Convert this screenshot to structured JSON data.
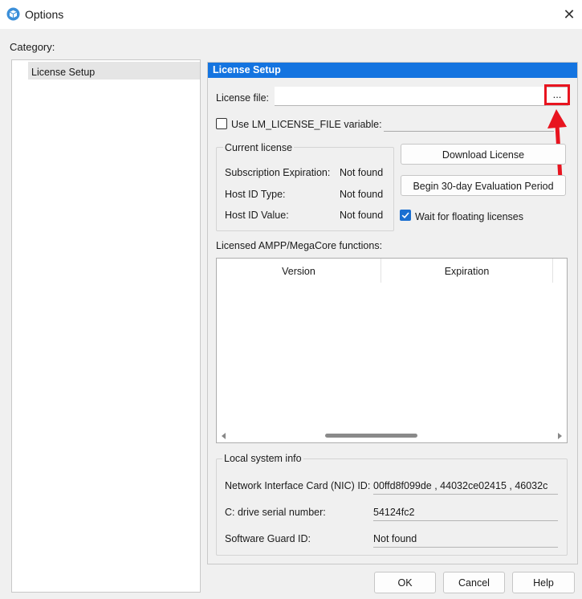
{
  "window": {
    "title": "Options",
    "close_glyph": "✕",
    "icon": "app-cube-icon"
  },
  "category": {
    "label": "Category:",
    "items": [
      {
        "label": "License Setup",
        "selected": true
      }
    ]
  },
  "panel": {
    "header": "License Setup",
    "license_file": {
      "label": "License file:",
      "value": "",
      "browse_label": "..."
    },
    "lm_variable": {
      "label": "Use LM_LICENSE_FILE variable:",
      "checked": false,
      "value": ""
    },
    "current_license": {
      "title": "Current license",
      "rows": [
        {
          "label": "Subscription Expiration:",
          "value": "Not found"
        },
        {
          "label": "Host ID Type:",
          "value": "Not found"
        },
        {
          "label": "Host ID Value:",
          "value": "Not found"
        }
      ]
    },
    "download_button": "Download License",
    "evaluation_button": "Begin 30-day Evaluation Period",
    "wait_floating": {
      "label": "Wait for floating licenses",
      "checked": true
    },
    "functions": {
      "label": "Licensed AMPP/MegaCore functions:",
      "columns": [
        "Version",
        "Expiration"
      ],
      "rows": []
    },
    "local_info": {
      "title": "Local system info",
      "rows": [
        {
          "label": "Network Interface Card (NIC) ID:",
          "value": "00ffd8f099de , 44032ce02415 , 46032c"
        },
        {
          "label": "C: drive serial number:",
          "value": "54124fc2"
        },
        {
          "label": "Software Guard ID:",
          "value": "Not found"
        }
      ]
    }
  },
  "buttons": {
    "ok": "OK",
    "cancel": "Cancel",
    "help": "Help"
  },
  "colors": {
    "accent": "#1474e0",
    "highlight": "#e8141f",
    "checkbox_checked": "#1a6fd1"
  }
}
